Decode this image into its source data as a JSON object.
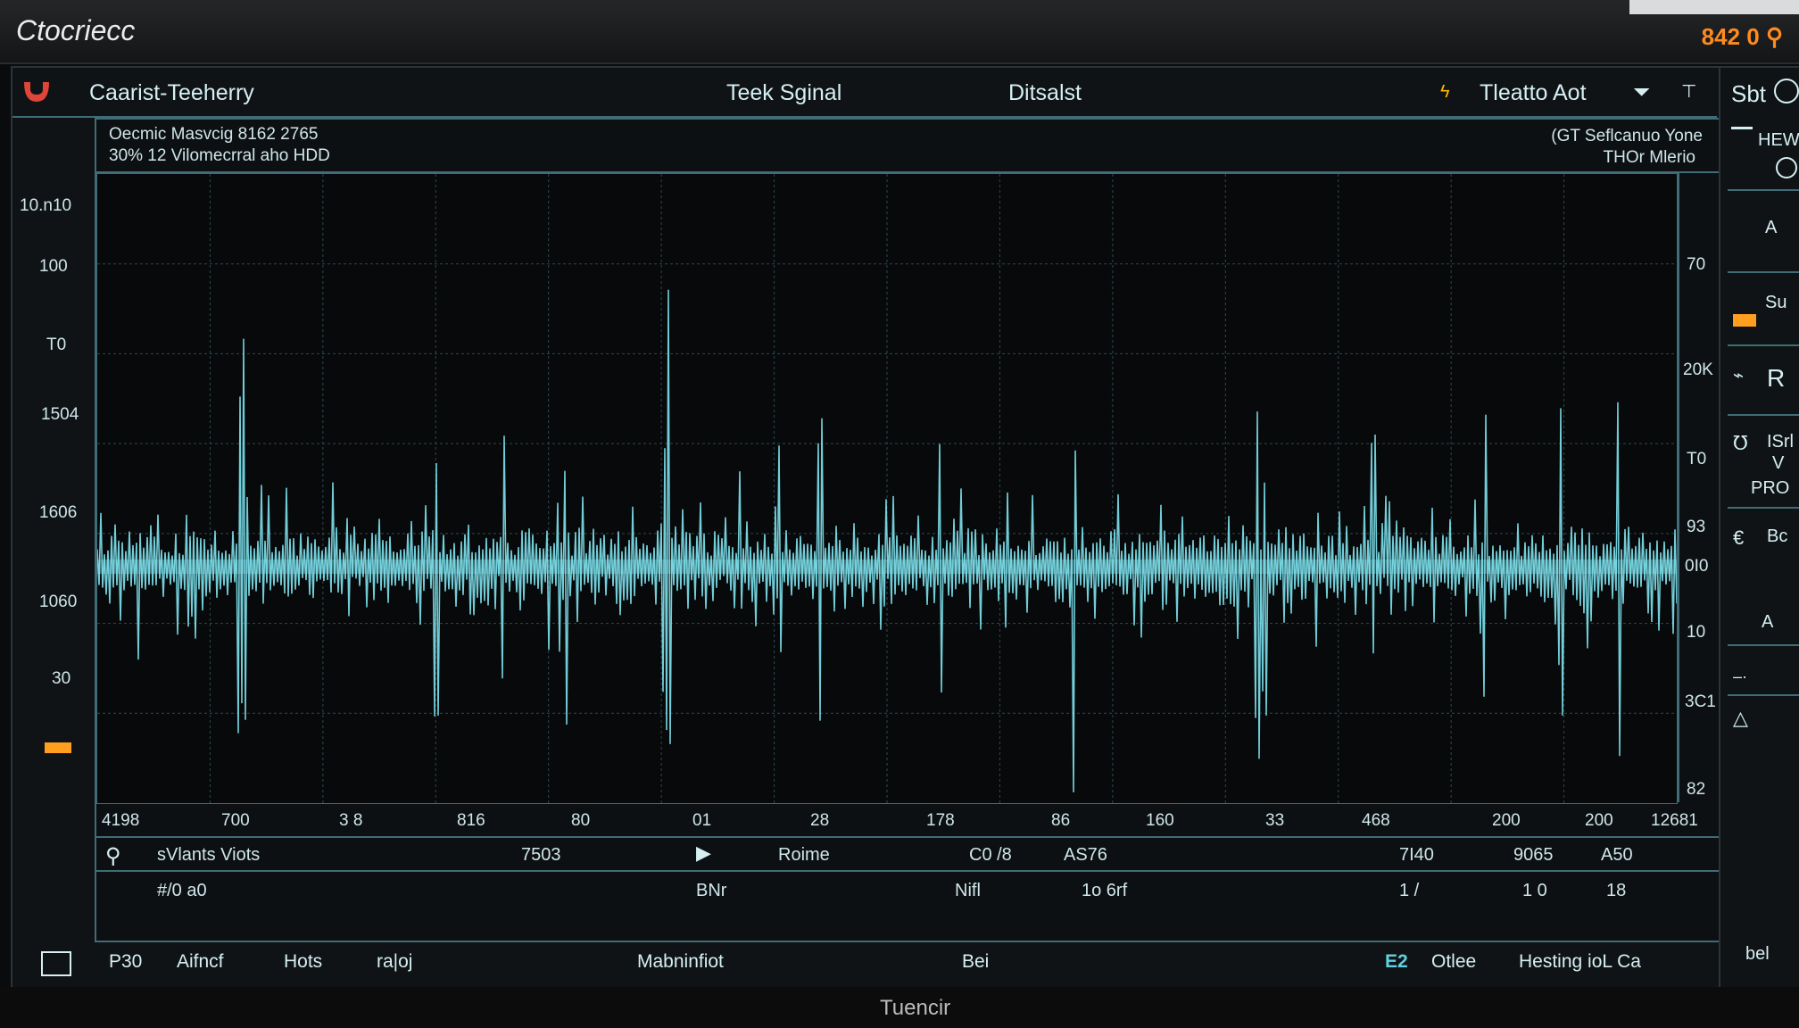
{
  "os": {
    "title": "Ctocriecc",
    "clock": "842 0 ⚲"
  },
  "header": {
    "title": "Caarist-Teeherry",
    "tab_signal": "Teek Sginal",
    "tab_display": "Ditsalst",
    "mode_label": "Tleatto Aot",
    "corner_label": "Sbt"
  },
  "info": {
    "line1": "Oecmic Masvcig 8162 2765",
    "line2": "30% 12 Vilomecrral aho HDD",
    "right1": "(GT Seflcanuo Yone",
    "right2": "THOr Mlerio"
  },
  "y_axis_left": [
    "10.n10",
    "100",
    "T0",
    "1504",
    "1606",
    "1060",
    "30"
  ],
  "y_axis_right": [
    "70",
    "20K",
    "T0",
    "93",
    "0I0",
    "10",
    "3C1",
    "82"
  ],
  "x_axis": [
    "4198",
    "700",
    "3 8",
    "816",
    "80",
    "01",
    "28",
    "178",
    "86",
    "160",
    "33",
    "468",
    "200",
    "200",
    "12681"
  ],
  "rows": {
    "r1": [
      "sVlants Viots",
      "7503",
      "Roime",
      "C0 /8",
      "AS76",
      "7I40",
      "9065",
      "A50"
    ],
    "r2": [
      "#/0 a0",
      "BNr",
      "Nifl",
      "1o 6rf",
      "1 /",
      "1 0",
      "18"
    ]
  },
  "footer": {
    "items": [
      "P30",
      "Aifncf",
      "Hots",
      "ra|oj",
      "Mabninfiot",
      "Bei",
      "E2",
      "Otlee",
      "Hesting ioL Ca"
    ]
  },
  "sidebar": {
    "items": [
      "HEW",
      "A",
      "Su",
      "R",
      "ISrl",
      "V",
      "PRO",
      "Bc",
      "A",
      "bel"
    ]
  },
  "bezel_brand": "Tuencir",
  "colors": {
    "trace": "#7ee3ee",
    "accent": "#3f6c77",
    "warning": "#ff9e1f",
    "logo": "#e0453a"
  }
}
